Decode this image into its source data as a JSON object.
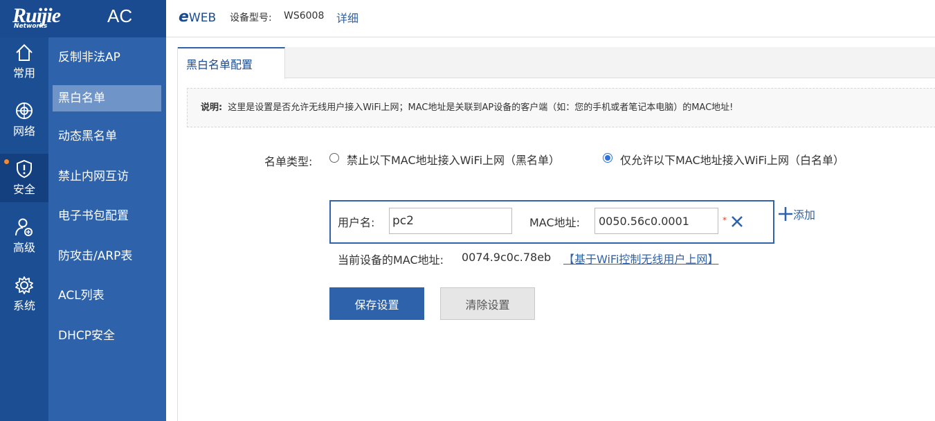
{
  "brand": {
    "logo": "Ruijie",
    "logo_sub": "Networks",
    "product": "AC",
    "eweb_e": "e",
    "eweb_rest": "WEB"
  },
  "header": {
    "model_label": "设备型号:",
    "model_value": "WS6008",
    "detail_link": "详细"
  },
  "rail": [
    {
      "label": "常用",
      "icon": "home-icon"
    },
    {
      "label": "网络",
      "icon": "network-icon"
    },
    {
      "label": "安全",
      "icon": "shield-icon",
      "active": true,
      "badge": true
    },
    {
      "label": "高级",
      "icon": "user-gear-icon"
    },
    {
      "label": "系统",
      "icon": "gear-icon"
    }
  ],
  "subnav": [
    {
      "label": "反制非法AP"
    },
    {
      "label": "黑白名单",
      "active": true
    },
    {
      "label": "动态黑名单"
    },
    {
      "label": "禁止内网互访"
    },
    {
      "label": "电子书包配置"
    },
    {
      "label": "防攻击/ARP表"
    },
    {
      "label": "ACL列表"
    },
    {
      "label": "DHCP安全"
    }
  ],
  "tabs": [
    {
      "label": "黑白名单配置",
      "active": true
    }
  ],
  "notice": {
    "title": "说明:",
    "text": "这里是设置是否允许无线用户接入WiFi上网；MAC地址是关联到AP设备的客户端（如：您的手机或者笔记本电脑）的MAC地址!"
  },
  "list_type": {
    "label": "名单类型:",
    "options": [
      {
        "label": "禁止以下MAC地址接入WiFi上网（黑名单）",
        "checked": false
      },
      {
        "label": "仅允许以下MAC地址接入WiFi上网（白名单）",
        "checked": true
      }
    ]
  },
  "entry": {
    "user_label": "用户名:",
    "user_value": "pc2",
    "mac_label": "MAC地址:",
    "mac_value": "0050.56c0.0001",
    "required_mark": "*",
    "add_label": "添加"
  },
  "current_mac": {
    "label": "当前设备的MAC地址:",
    "value": "0074.9c0c.78eb",
    "link": "【基于WiFi控制无线用户上网】"
  },
  "actions": {
    "save": "保存设置",
    "clear": "清除设置"
  },
  "colors": {
    "rail": "#1c4e94",
    "subnav": "#2e62aa",
    "accent": "#2e62aa",
    "radio": "#2e72d8",
    "required": "#e0401a"
  }
}
